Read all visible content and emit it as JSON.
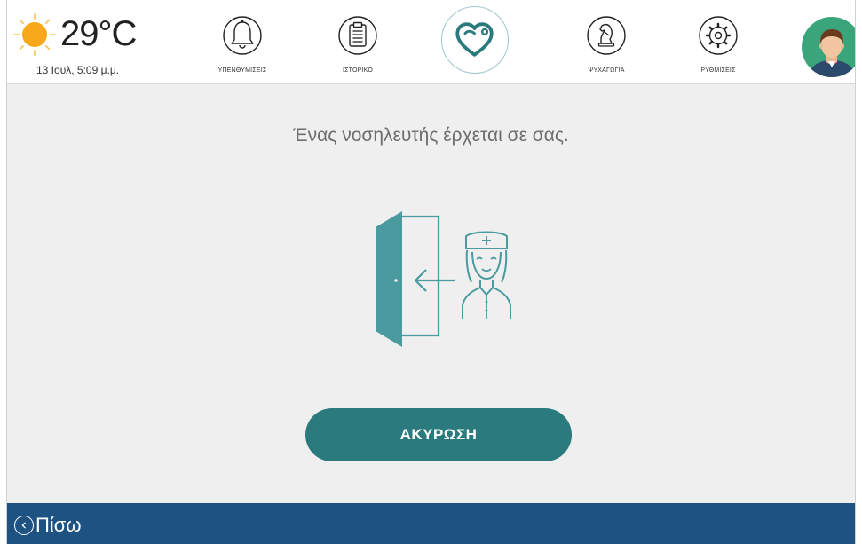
{
  "header": {
    "weather": {
      "temperature": "29°C",
      "datetime": "13 Ιουλ, 5:09 μ.μ.",
      "icon": "sun-icon"
    },
    "nav": [
      {
        "label": "ΥΠΕΝΘΥΜΙΣΕΙΣ",
        "icon": "bell-icon"
      },
      {
        "label": "ΙΣΤΟΡΙΚΟ",
        "icon": "clipboard-icon"
      },
      {
        "label": "ΨΥΧΑΓΩΓΙΑ",
        "icon": "chess-knight-icon"
      },
      {
        "label": "ΡΥΘΜΙΣΕΙΣ",
        "icon": "gear-icon"
      }
    ],
    "home_icon": "heart-stethoscope-icon",
    "avatar_icon": "user-avatar-icon"
  },
  "main": {
    "message": "Ένας νοσηλευτής έρχεται σε σας.",
    "illustration_icon": "nurse-entering-door-icon",
    "cancel_label": "ΑΚΥΡΩΣΗ"
  },
  "footer": {
    "back_label": "Πίσω",
    "back_icon": "chevron-left-icon"
  },
  "colors": {
    "accent_teal": "#2a7a7e",
    "footer_blue": "#1e5282",
    "background": "#efefef",
    "sun": "#f7a81b",
    "avatar_bg": "#3aa57a"
  }
}
